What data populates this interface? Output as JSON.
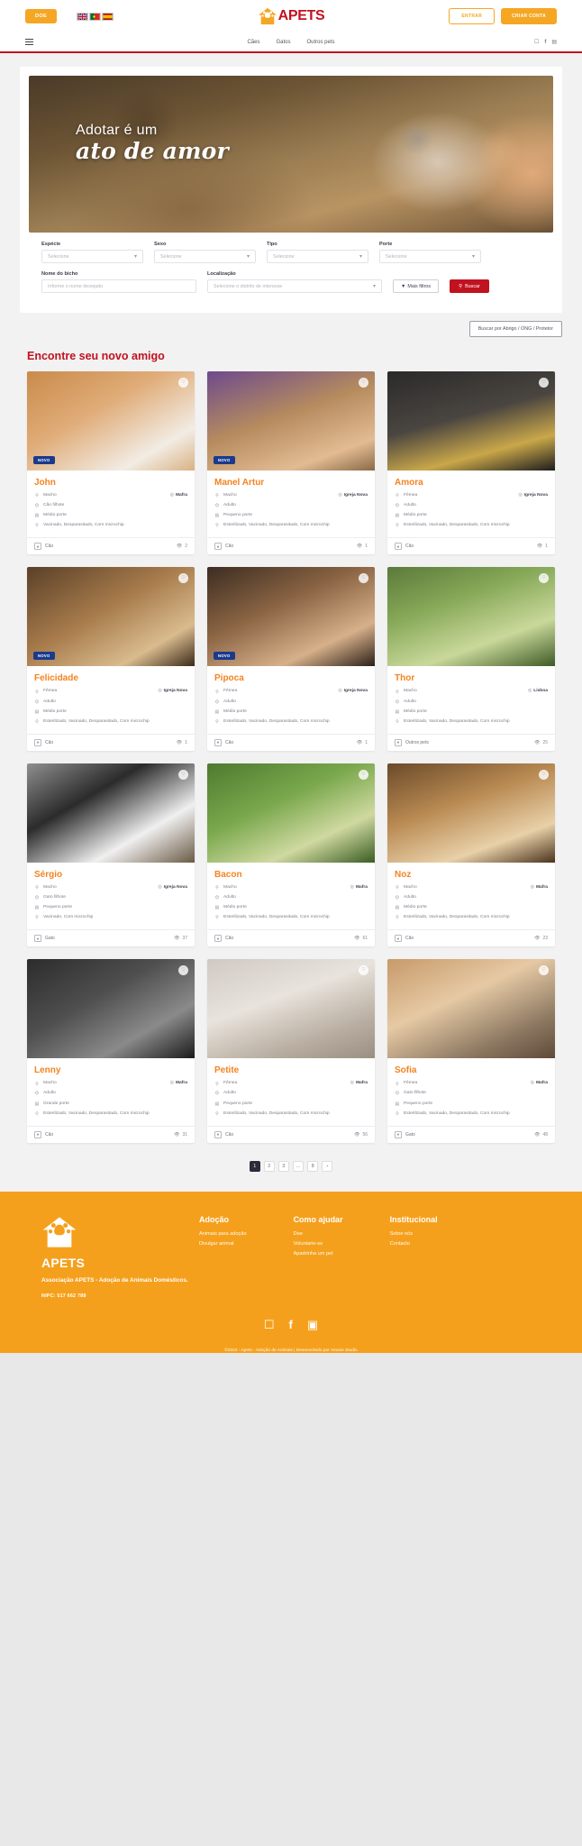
{
  "topbar": {
    "donate_label": "DOE",
    "login_label": "ENTRAR",
    "signup_label": "CRIAR CONTA",
    "brand": "APETS",
    "flags": [
      "uk-flag",
      "portugal-flag",
      "spain-flag"
    ]
  },
  "nav": {
    "links": [
      "Cães",
      "Gatos",
      "Outros pets"
    ],
    "social": [
      "instagram-icon",
      "facebook-icon",
      "youtube-icon"
    ]
  },
  "hero": {
    "line1": "Adotar é um",
    "line2": "ato de amor"
  },
  "filters": {
    "especie": {
      "label": "Espécie",
      "value": "Selecione"
    },
    "sexo": {
      "label": "Sexo",
      "value": "Selecione"
    },
    "tipo": {
      "label": "Tipo",
      "value": "Selecione"
    },
    "porte": {
      "label": "Porte",
      "value": "Selecione"
    },
    "nome": {
      "label": "Nome do bicho",
      "placeholder": "Informe o nome desejado",
      "value": ""
    },
    "localizacao": {
      "label": "Localização",
      "value": "Selecione o distrito de interesse"
    },
    "mais_filtros_label": "Mais filtros",
    "buscar_label": "Buscar",
    "abrigo_label": "Buscar por Abrigo / ONG / Protetor"
  },
  "section": {
    "title": "Encontre seu novo amigo"
  },
  "pets": [
    {
      "name": "John",
      "badge": "NOVO",
      "sexo": "Macho",
      "tipo": "Cão filhote",
      "porte": "Médio porte",
      "saude": "Vacinado, Desparasitado, Com microchip",
      "local": "Mafra",
      "especie": "Cão",
      "views": "2"
    },
    {
      "name": "Manel Artur",
      "badge": "NOVO",
      "sexo": "Macho",
      "tipo": "Adulto",
      "porte": "Pequeno porte",
      "saude": "Esterilizado, Vacinado, Desparasitado, Com microchip",
      "local": "Igreja Nova",
      "especie": "Cão",
      "views": "1"
    },
    {
      "name": "Amora",
      "badge": "",
      "sexo": "Fêmea",
      "tipo": "Adulto",
      "porte": "Médio porte",
      "saude": "Esterilizado, Vacinado, Desparasitado, Com microchip",
      "local": "Igreja Nova",
      "especie": "Cão",
      "views": "1"
    },
    {
      "name": "Felicidade",
      "badge": "NOVO",
      "sexo": "Fêmea",
      "tipo": "Adulto",
      "porte": "Médio porte",
      "saude": "Esterilizado, Vacinado, Desparasitado, Com microchip",
      "local": "Igreja Nova",
      "especie": "Cão",
      "views": "1"
    },
    {
      "name": "Pipoca",
      "badge": "NOVO",
      "sexo": "Fêmea",
      "tipo": "Adulto",
      "porte": "Médio porte",
      "saude": "Esterilizado, Vacinado, Desparasitado, Com microchip",
      "local": "Igreja Nova",
      "especie": "Cão",
      "views": "1"
    },
    {
      "name": "Thor",
      "badge": "",
      "sexo": "Macho",
      "tipo": "Adulto",
      "porte": "Médio porte",
      "saude": "Esterilizado, Vacinado, Desparasitado, Com microchip",
      "local": "Lisboa",
      "especie": "Outros pets",
      "views": "25"
    },
    {
      "name": "Sérgio",
      "badge": "",
      "sexo": "Macho",
      "tipo": "Gato filhote",
      "porte": "Pequeno porte",
      "saude": "Vacinado, Com microchip",
      "local": "Igreja Nova",
      "especie": "Gato",
      "views": "37"
    },
    {
      "name": "Bacon",
      "badge": "",
      "sexo": "Macho",
      "tipo": "Adulto",
      "porte": "Médio porte",
      "saude": "Esterilizado, Vacinado, Desparasitado, Com microchip",
      "local": "Mafra",
      "especie": "Cão",
      "views": "61"
    },
    {
      "name": "Noz",
      "badge": "",
      "sexo": "Macho",
      "tipo": "Adulto",
      "porte": "Médio porte",
      "saude": "Esterilizado, Vacinado, Desparasitado, Com microchip",
      "local": "Mafra",
      "especie": "Cão",
      "views": "23"
    },
    {
      "name": "Lenny",
      "badge": "",
      "sexo": "Macho",
      "tipo": "Adulto",
      "porte": "Grande porte",
      "saude": "Esterilizado, Vacinado, Desparasitado, Com microchip",
      "local": "Mafra",
      "especie": "Cão",
      "views": "31"
    },
    {
      "name": "Petite",
      "badge": "",
      "sexo": "Fêmea",
      "tipo": "Adulto",
      "porte": "Pequeno porte",
      "saude": "Esterilizado, Vacinado, Desparasitado, Com microchip",
      "local": "Mafra",
      "especie": "Cão",
      "views": "56"
    },
    {
      "name": "Sofia",
      "badge": "",
      "sexo": "Fêmea",
      "tipo": "Gato filhote",
      "porte": "Pequeno porte",
      "saude": "Esterilizado, Vacinado, Desparasitado, Com microchip",
      "local": "Mafra",
      "especie": "Gato",
      "views": "48"
    }
  ],
  "pagination": {
    "pages": [
      "1",
      "2",
      "3",
      "...",
      "8",
      "›"
    ],
    "active": "1"
  },
  "footer": {
    "brand": "APETS",
    "description": "Associação APETS - Adoção de Animais Domésticos.",
    "nipc": "NIPC: 517 662 788",
    "columns": [
      {
        "title": "Adoção",
        "links": [
          "Animais para adoção",
          "Divulgar animal"
        ]
      },
      {
        "title": "Como ajudar",
        "links": [
          "Doe",
          "Voluntarie-se",
          "Apadrinha um pet"
        ]
      },
      {
        "title": "Institucional",
        "links": [
          "Sobre nós",
          "Contacto"
        ]
      }
    ],
    "social": [
      "instagram-icon",
      "facebook-icon",
      "youtube-icon"
    ],
    "copyright": "©2022 - Apets - Adoção de Animais | Desenvolvido por  Amaze Studio"
  },
  "colors": {
    "brand_red": "#c1121f",
    "brand_orange": "#f5a623",
    "pet_name_orange": "#f5821f",
    "footer_orange": "#f5a01c",
    "badge_blue": "#1b3a8c"
  }
}
